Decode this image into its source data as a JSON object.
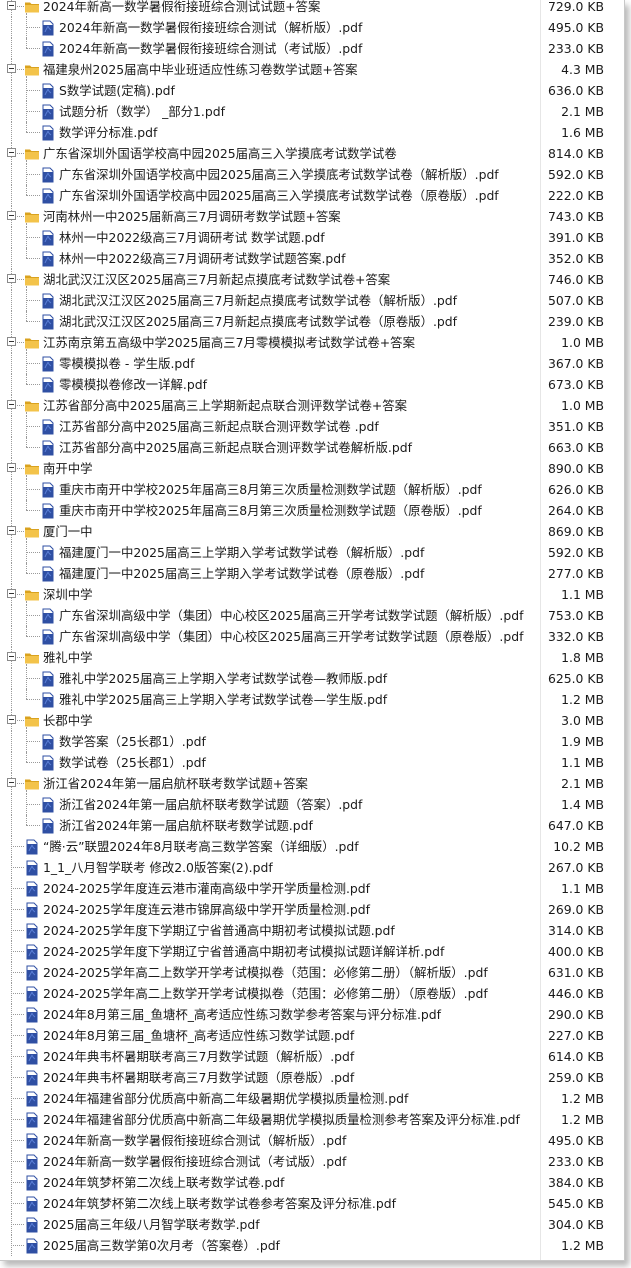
{
  "colors": {
    "folder": "#f3c34a",
    "folder_dark": "#d9a21f",
    "pdf": "#2f4fa3",
    "pdf_light": "#5b7fd6",
    "text": "#1a1a1a"
  },
  "icons": {
    "folder": "folder-icon",
    "file": "pdf-file-icon",
    "toggle": "collapse-toggle-icon"
  },
  "rows": [
    {
      "level": 0,
      "type": "folder",
      "name": "2024年新高一数学暑假衔接班综合测试试题+答案",
      "size": "729.0 KB"
    },
    {
      "level": 1,
      "type": "file",
      "name": "2024年新高一数学暑假衔接班综合测试（解析版）.pdf",
      "size": "495.0 KB"
    },
    {
      "level": 1,
      "type": "file",
      "name": "2024年新高一数学暑假衔接班综合测试（考试版）.pdf",
      "size": "233.0 KB"
    },
    {
      "level": 0,
      "type": "folder",
      "name": "福建泉州2025届高中毕业班适应性练习卷数学试题+答案",
      "size": "4.3 MB"
    },
    {
      "level": 1,
      "type": "file",
      "name": "S数学试题(定稿).pdf",
      "size": "636.0 KB"
    },
    {
      "level": 1,
      "type": "file",
      "name": "试题分析（数学） _部分1.pdf",
      "size": "2.1 MB"
    },
    {
      "level": 1,
      "type": "file",
      "name": "数学评分标准.pdf",
      "size": "1.6 MB"
    },
    {
      "level": 0,
      "type": "folder",
      "name": "广东省深圳外国语学校高中园2025届高三入学摸底考试数学试卷",
      "size": "814.0 KB"
    },
    {
      "level": 1,
      "type": "file",
      "name": "广东省深圳外国语学校高中园2025届高三入学摸底考试数学试卷（解析版）.pdf",
      "size": "592.0 KB"
    },
    {
      "level": 1,
      "type": "file",
      "name": "广东省深圳外国语学校高中园2025届高三入学摸底考试数学试卷（原卷版）.pdf",
      "size": "222.0 KB"
    },
    {
      "level": 0,
      "type": "folder",
      "name": "河南林州一中2025届新高三7月调研考数学试题+答案",
      "size": "743.0 KB"
    },
    {
      "level": 1,
      "type": "file",
      "name": "林州一中2022级高三7月调研考试 数学试题.pdf",
      "size": "391.0 KB"
    },
    {
      "level": 1,
      "type": "file",
      "name": "林州一中2022级高三7月调研考试数学试题答案.pdf",
      "size": "352.0 KB"
    },
    {
      "level": 0,
      "type": "folder",
      "name": "湖北武汉江汉区2025届高三7月新起点摸底考试数学试卷+答案",
      "size": "746.0 KB"
    },
    {
      "level": 1,
      "type": "file",
      "name": "湖北武汉江汉区2025届高三7月新起点摸底考试数学试卷（解析版）.pdf",
      "size": "507.0 KB"
    },
    {
      "level": 1,
      "type": "file",
      "name": "湖北武汉江汉区2025届高三7月新起点摸底考试数学试卷（原卷版）.pdf",
      "size": "239.0 KB"
    },
    {
      "level": 0,
      "type": "folder",
      "name": "江苏南京第五高级中学2025届高三7月零模模拟考试数学试卷+答案",
      "size": "1.0 MB"
    },
    {
      "level": 1,
      "type": "file",
      "name": "零模模拟卷 - 学生版.pdf",
      "size": "367.0 KB"
    },
    {
      "level": 1,
      "type": "file",
      "name": "零模模拟卷修改一详解.pdf",
      "size": "673.0 KB"
    },
    {
      "level": 0,
      "type": "folder",
      "name": "江苏省部分高中2025届高三上学期新起点联合测评数学试卷+答案",
      "size": "1.0 MB"
    },
    {
      "level": 1,
      "type": "file",
      "name": "江苏省部分高中2025届高三新起点联合测评数学试卷 .pdf",
      "size": "351.0 KB"
    },
    {
      "level": 1,
      "type": "file",
      "name": "江苏省部分高中2025届高三新起点联合测评数学试卷解析版.pdf",
      "size": "663.0 KB"
    },
    {
      "level": 0,
      "type": "folder",
      "name": "南开中学",
      "size": "890.0 KB"
    },
    {
      "level": 1,
      "type": "file",
      "name": "重庆市南开中学校2025年届高三8月第三次质量检测数学试题（解析版）.pdf",
      "size": "626.0 KB"
    },
    {
      "level": 1,
      "type": "file",
      "name": "重庆市南开中学校2025年届高三8月第三次质量检测数学试题（原卷版）.pdf",
      "size": "264.0 KB"
    },
    {
      "level": 0,
      "type": "folder",
      "name": "厦门一中",
      "size": "869.0 KB"
    },
    {
      "level": 1,
      "type": "file",
      "name": "福建厦门一中2025届高三上学期入学考试数学试卷（解析版）.pdf",
      "size": "592.0 KB"
    },
    {
      "level": 1,
      "type": "file",
      "name": "福建厦门一中2025届高三上学期入学考试数学试卷（原卷版）.pdf",
      "size": "277.0 KB"
    },
    {
      "level": 0,
      "type": "folder",
      "name": "深圳中学",
      "size": "1.1 MB"
    },
    {
      "level": 1,
      "type": "file",
      "name": "广东省深圳高级中学（集团）中心校区2025届高三开学考试数学试题（解析版）.pdf",
      "size": "753.0 KB"
    },
    {
      "level": 1,
      "type": "file",
      "name": "广东省深圳高级中学（集团）中心校区2025届高三开学考试数学试题（原卷版）.pdf",
      "size": "332.0 KB"
    },
    {
      "level": 0,
      "type": "folder",
      "name": "雅礼中学",
      "size": "1.8 MB"
    },
    {
      "level": 1,
      "type": "file",
      "name": "雅礼中学2025届高三上学期入学考试数学试卷—教师版.pdf",
      "size": "625.0 KB"
    },
    {
      "level": 1,
      "type": "file",
      "name": "雅礼中学2025届高三上学期入学考试数学试卷—学生版.pdf",
      "size": "1.2 MB"
    },
    {
      "level": 0,
      "type": "folder",
      "name": "长郡中学",
      "size": "3.0 MB"
    },
    {
      "level": 1,
      "type": "file",
      "name": "数学答案（25长郡1）.pdf",
      "size": "1.9 MB"
    },
    {
      "level": 1,
      "type": "file",
      "name": "数学试卷（25长郡1）.pdf",
      "size": "1.1 MB"
    },
    {
      "level": 0,
      "type": "folder",
      "name": "浙江省2024年第一届启航杯联考数学试题+答案",
      "size": "2.1 MB"
    },
    {
      "level": 1,
      "type": "file",
      "name": "浙江省2024年第一届启航杯联考数学试题（答案）.pdf",
      "size": "1.4 MB"
    },
    {
      "level": 1,
      "type": "file",
      "name": "浙江省2024年第一届启航杯联考数学试题.pdf",
      "size": "647.0 KB"
    },
    {
      "level": 0,
      "type": "file",
      "name": "“腾·云”联盟2024年8月联考高三数学答案（详细版）.pdf",
      "size": "10.2 MB"
    },
    {
      "level": 0,
      "type": "file",
      "name": "1_1_八月智学联考 修改2.0版答案(2).pdf",
      "size": "267.0 KB"
    },
    {
      "level": 0,
      "type": "file",
      "name": "2024-2025学年度连云港市灌南高级中学开学质量检测.pdf",
      "size": "1.1 MB"
    },
    {
      "level": 0,
      "type": "file",
      "name": "2024-2025学年度连云港市锦屏高级中学开学质量检测.pdf",
      "size": "269.0 KB"
    },
    {
      "level": 0,
      "type": "file",
      "name": "2024-2025学年度下学期辽宁省普通高中期初考试模拟试题.pdf",
      "size": "314.0 KB"
    },
    {
      "level": 0,
      "type": "file",
      "name": "2024-2025学年度下学期辽宁省普通高中期初考试模拟试题详解详析.pdf",
      "size": "400.0 KB"
    },
    {
      "level": 0,
      "type": "file",
      "name": "2024-2025学年高二上数学开学考试模拟卷（范围：必修第二册）（解析版）.pdf",
      "size": "631.0 KB"
    },
    {
      "level": 0,
      "type": "file",
      "name": "2024-2025学年高二上数学开学考试模拟卷（范围：必修第二册）（原卷版）.pdf",
      "size": "446.0 KB"
    },
    {
      "level": 0,
      "type": "file",
      "name": "2024年8月第三届_鱼塘杯_高考适应性练习数学参考答案与评分标准.pdf",
      "size": "290.0 KB"
    },
    {
      "level": 0,
      "type": "file",
      "name": "2024年8月第三届_鱼塘杯_高考适应性练习数学试题.pdf",
      "size": "227.0 KB"
    },
    {
      "level": 0,
      "type": "file",
      "name": "2024年典韦杯暑期联考高三7月数学试题（解析版）.pdf",
      "size": "614.0 KB"
    },
    {
      "level": 0,
      "type": "file",
      "name": "2024年典韦杯暑期联考高三7月数学试题（原卷版）.pdf",
      "size": "259.0 KB"
    },
    {
      "level": 0,
      "type": "file",
      "name": "2024年福建省部分优质高中新高二年级暑期优学模拟质量检测.pdf",
      "size": "1.2 MB"
    },
    {
      "level": 0,
      "type": "file",
      "name": "2024年福建省部分优质高中新高二年级暑期优学模拟质量检测参考答案及评分标准.pdf",
      "size": "1.2 MB"
    },
    {
      "level": 0,
      "type": "file",
      "name": "2024年新高一数学暑假衔接班综合测试（解析版）.pdf",
      "size": "495.0 KB"
    },
    {
      "level": 0,
      "type": "file",
      "name": "2024年新高一数学暑假衔接班综合测试（考试版）.pdf",
      "size": "233.0 KB"
    },
    {
      "level": 0,
      "type": "file",
      "name": "2024年筑梦杯第二次线上联考数学试卷.pdf",
      "size": "384.0 KB"
    },
    {
      "level": 0,
      "type": "file",
      "name": "2024年筑梦杯第二次线上联考数学试卷参考答案及评分标准.pdf",
      "size": "545.0 KB"
    },
    {
      "level": 0,
      "type": "file",
      "name": "2025届高三年级八月智学联考数学.pdf",
      "size": "304.0 KB"
    },
    {
      "level": 0,
      "type": "file",
      "name": "2025届高三数学第0次月考（答案卷）.pdf",
      "size": "1.2 MB"
    }
  ]
}
